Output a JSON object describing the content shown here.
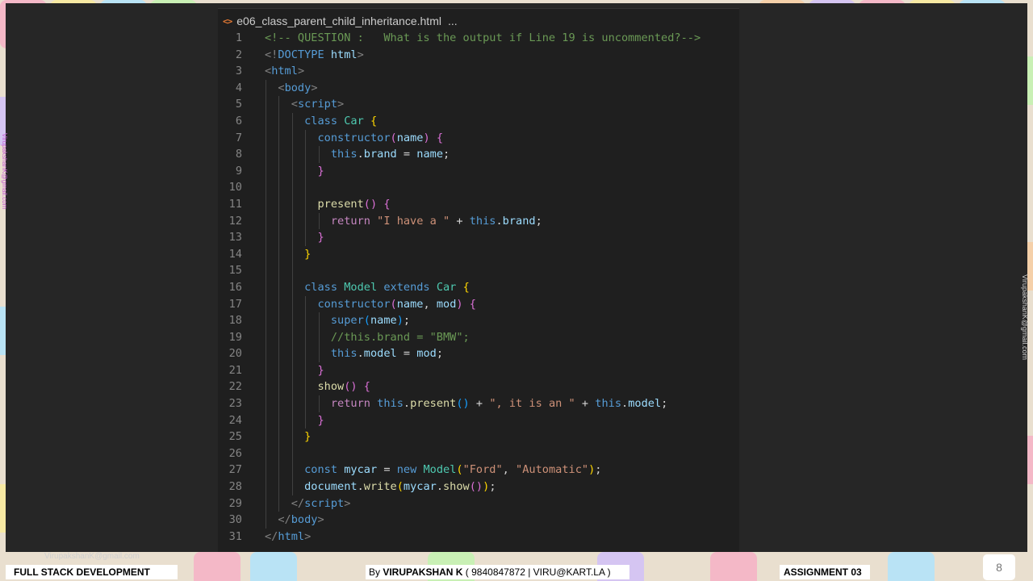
{
  "editor": {
    "tab": {
      "icon": "html-file-icon",
      "icon_glyph": "<>",
      "filename": "e06_class_parent_child_inheritance.html",
      "ellipsis": "..."
    },
    "lines": [
      {
        "num": "1",
        "indent": 0,
        "tokens": [
          [
            "com",
            "<!-- QUESTION :   What is the output if Line 19 is uncommented?-->"
          ]
        ]
      },
      {
        "num": "2",
        "indent": 0,
        "tokens": [
          [
            "tag",
            "<!"
          ],
          [
            "tname",
            "DOCTYPE"
          ],
          [
            "",
            " "
          ],
          [
            "var",
            "html"
          ],
          [
            "tag",
            ">"
          ]
        ]
      },
      {
        "num": "3",
        "indent": 0,
        "tokens": [
          [
            "tag",
            "<"
          ],
          [
            "tname",
            "html"
          ],
          [
            "tag",
            ">"
          ]
        ]
      },
      {
        "num": "4",
        "indent": 1,
        "tokens": [
          [
            "tag",
            "<"
          ],
          [
            "tname",
            "body"
          ],
          [
            "tag",
            ">"
          ]
        ]
      },
      {
        "num": "5",
        "indent": 2,
        "tokens": [
          [
            "tag",
            "<"
          ],
          [
            "tname",
            "script"
          ],
          [
            "tag",
            ">"
          ]
        ]
      },
      {
        "num": "6",
        "indent": 3,
        "tokens": [
          [
            "kw",
            "class"
          ],
          [
            "",
            " "
          ],
          [
            "cls",
            "Car"
          ],
          [
            "",
            " "
          ],
          [
            "b1",
            "{"
          ]
        ]
      },
      {
        "num": "7",
        "indent": 4,
        "tokens": [
          [
            "kw",
            "constructor"
          ],
          [
            "b2",
            "("
          ],
          [
            "var",
            "name"
          ],
          [
            "b2",
            ")"
          ],
          [
            "",
            " "
          ],
          [
            "b2",
            "{"
          ]
        ]
      },
      {
        "num": "8",
        "indent": 5,
        "tokens": [
          [
            "kw",
            "this"
          ],
          [
            "",
            "."
          ],
          [
            "var",
            "brand"
          ],
          [
            "",
            " = "
          ],
          [
            "var",
            "name"
          ],
          [
            "",
            ";"
          ]
        ]
      },
      {
        "num": "9",
        "indent": 4,
        "tokens": [
          [
            "b2",
            "}"
          ]
        ]
      },
      {
        "num": "10",
        "indent": 4,
        "tokens": []
      },
      {
        "num": "11",
        "indent": 4,
        "tokens": [
          [
            "fn",
            "present"
          ],
          [
            "b2",
            "()"
          ],
          [
            "",
            " "
          ],
          [
            "b2",
            "{"
          ]
        ]
      },
      {
        "num": "12",
        "indent": 5,
        "tokens": [
          [
            "ctrl",
            "return"
          ],
          [
            "",
            " "
          ],
          [
            "str",
            "\"I have a \""
          ],
          [
            "",
            " + "
          ],
          [
            "kw",
            "this"
          ],
          [
            "",
            "."
          ],
          [
            "var",
            "brand"
          ],
          [
            "",
            ";"
          ]
        ]
      },
      {
        "num": "13",
        "indent": 4,
        "tokens": [
          [
            "b2",
            "}"
          ]
        ]
      },
      {
        "num": "14",
        "indent": 3,
        "tokens": [
          [
            "b1",
            "}"
          ]
        ]
      },
      {
        "num": "15",
        "indent": 3,
        "tokens": []
      },
      {
        "num": "16",
        "indent": 3,
        "tokens": [
          [
            "kw",
            "class"
          ],
          [
            "",
            " "
          ],
          [
            "cls",
            "Model"
          ],
          [
            "",
            " "
          ],
          [
            "kw",
            "extends"
          ],
          [
            "",
            " "
          ],
          [
            "cls",
            "Car"
          ],
          [
            "",
            " "
          ],
          [
            "b1",
            "{"
          ]
        ]
      },
      {
        "num": "17",
        "indent": 4,
        "tokens": [
          [
            "kw",
            "constructor"
          ],
          [
            "b2",
            "("
          ],
          [
            "var",
            "name"
          ],
          [
            "",
            ", "
          ],
          [
            "var",
            "mod"
          ],
          [
            "b2",
            ")"
          ],
          [
            "",
            " "
          ],
          [
            "b2",
            "{"
          ]
        ]
      },
      {
        "num": "18",
        "indent": 5,
        "tokens": [
          [
            "kw",
            "super"
          ],
          [
            "b3",
            "("
          ],
          [
            "var",
            "name"
          ],
          [
            "b3",
            ")"
          ],
          [
            "",
            ";"
          ]
        ]
      },
      {
        "num": "19",
        "indent": 5,
        "tokens": [
          [
            "com",
            "//this.brand = \"BMW\";"
          ]
        ]
      },
      {
        "num": "20",
        "indent": 5,
        "tokens": [
          [
            "kw",
            "this"
          ],
          [
            "",
            "."
          ],
          [
            "var",
            "model"
          ],
          [
            "",
            " = "
          ],
          [
            "var",
            "mod"
          ],
          [
            "",
            ";"
          ]
        ]
      },
      {
        "num": "21",
        "indent": 4,
        "tokens": [
          [
            "b2",
            "}"
          ]
        ]
      },
      {
        "num": "22",
        "indent": 4,
        "tokens": [
          [
            "fn",
            "show"
          ],
          [
            "b2",
            "()"
          ],
          [
            "",
            " "
          ],
          [
            "b2",
            "{"
          ]
        ]
      },
      {
        "num": "23",
        "indent": 5,
        "tokens": [
          [
            "ctrl",
            "return"
          ],
          [
            "",
            " "
          ],
          [
            "kw",
            "this"
          ],
          [
            "",
            "."
          ],
          [
            "fn",
            "present"
          ],
          [
            "b3",
            "()"
          ],
          [
            "",
            " + "
          ],
          [
            "str",
            "\", it is an \""
          ],
          [
            "",
            " + "
          ],
          [
            "kw",
            "this"
          ],
          [
            "",
            "."
          ],
          [
            "var",
            "model"
          ],
          [
            "",
            ";"
          ]
        ]
      },
      {
        "num": "24",
        "indent": 4,
        "tokens": [
          [
            "b2",
            "}"
          ]
        ]
      },
      {
        "num": "25",
        "indent": 3,
        "tokens": [
          [
            "b1",
            "}"
          ]
        ]
      },
      {
        "num": "26",
        "indent": 3,
        "tokens": []
      },
      {
        "num": "27",
        "indent": 3,
        "tokens": [
          [
            "kw",
            "const"
          ],
          [
            "",
            " "
          ],
          [
            "var",
            "mycar"
          ],
          [
            "",
            " = "
          ],
          [
            "kw",
            "new"
          ],
          [
            "",
            " "
          ],
          [
            "cls",
            "Model"
          ],
          [
            "b1",
            "("
          ],
          [
            "str",
            "\"Ford\""
          ],
          [
            "",
            ", "
          ],
          [
            "str",
            "\"Automatic\""
          ],
          [
            "b1",
            ")"
          ],
          [
            "",
            ";"
          ]
        ]
      },
      {
        "num": "28",
        "indent": 3,
        "tokens": [
          [
            "var",
            "document"
          ],
          [
            "",
            "."
          ],
          [
            "fn",
            "write"
          ],
          [
            "b1",
            "("
          ],
          [
            "var",
            "mycar"
          ],
          [
            "",
            "."
          ],
          [
            "fn",
            "show"
          ],
          [
            "b2",
            "()"
          ],
          [
            "b1",
            ")"
          ],
          [
            "",
            ";"
          ]
        ]
      },
      {
        "num": "29",
        "indent": 2,
        "tokens": [
          [
            "tag",
            "</"
          ],
          [
            "tname",
            "script"
          ],
          [
            "tag",
            ">"
          ]
        ]
      },
      {
        "num": "30",
        "indent": 1,
        "tokens": [
          [
            "tag",
            "</"
          ],
          [
            "tname",
            "body"
          ],
          [
            "tag",
            ">"
          ]
        ]
      },
      {
        "num": "31",
        "indent": 0,
        "tokens": [
          [
            "tag",
            "</"
          ],
          [
            "tname",
            "html"
          ],
          [
            "tag",
            ">"
          ]
        ]
      }
    ]
  },
  "watermarks": {
    "left": "VirupakshanK@gmail.com",
    "right": "VirupakshanK@gmail.com",
    "bottom": "VirupakshanK@gmail.com"
  },
  "footer": {
    "course": "FULL STACK DEVELOPMENT",
    "author_prefix": "By ",
    "author_name": "VIRUPAKSHAN K",
    "author_contact": " ( 9840847872 | VIRU@KART.LA )",
    "assignment": "ASSIGNMENT 03",
    "page_number": "8"
  },
  "colors": {
    "background": "#262626",
    "editor": "#1f1f1f",
    "comment": "#6a9955",
    "keyword": "#569cd6",
    "control": "#c586c0",
    "class": "#4ec9b0",
    "function": "#dcdcaa",
    "variable": "#9cdcfe",
    "string": "#ce9178"
  }
}
